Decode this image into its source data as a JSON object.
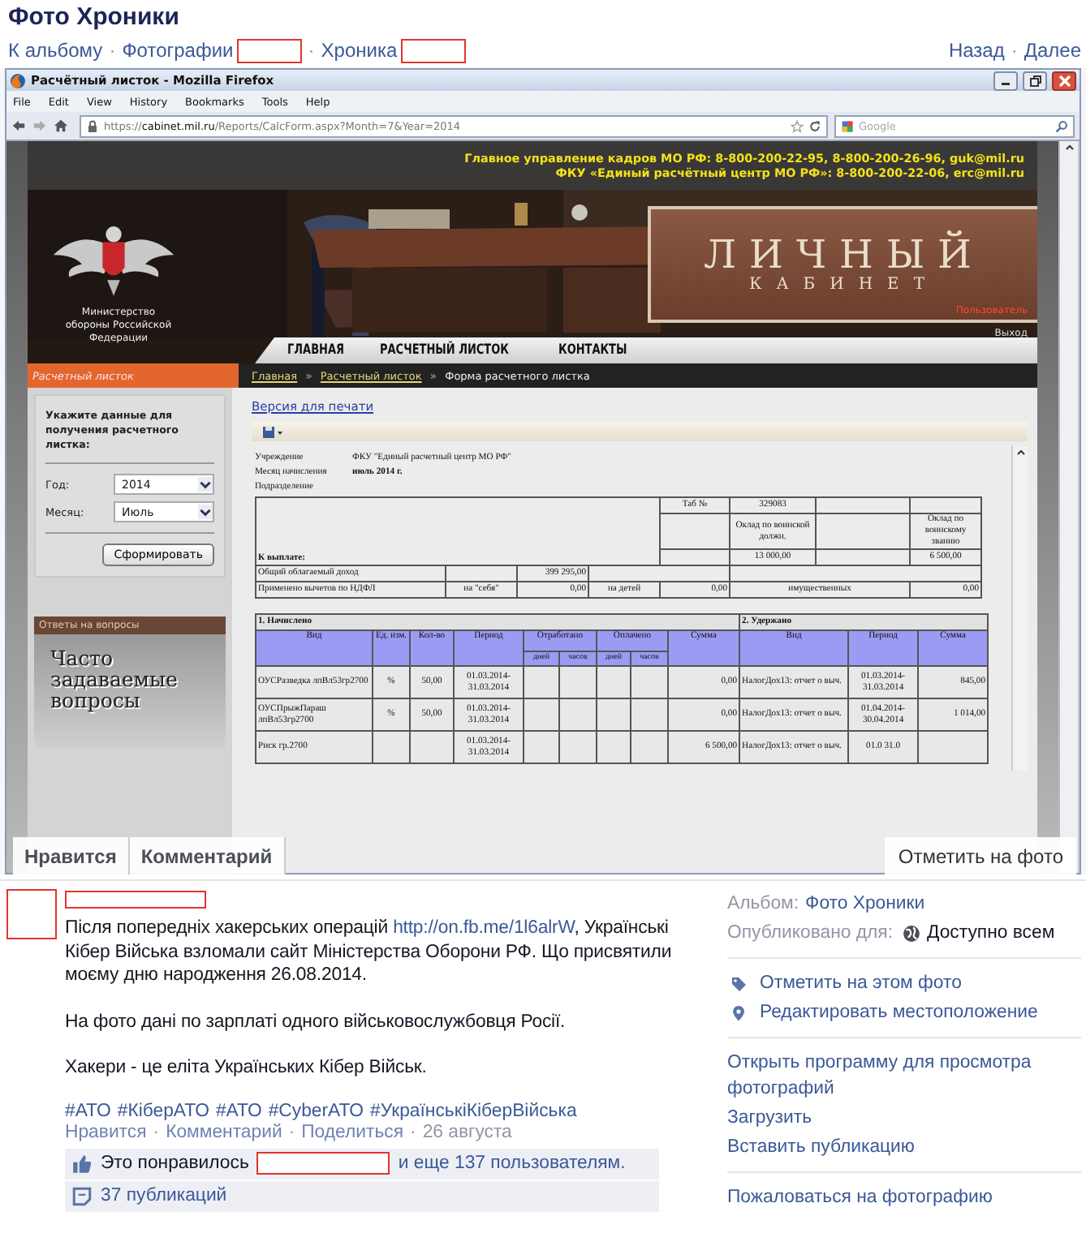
{
  "page_title": "Фото Хроники",
  "nav": {
    "separator": "·",
    "left": [
      {
        "label": "К альбому",
        "redacted": false
      },
      {
        "label": "Фотографии",
        "redacted": true
      },
      {
        "label": "Хроника",
        "redacted": true
      }
    ],
    "right": [
      "Назад",
      "Далее"
    ]
  },
  "photo": {
    "browser": {
      "title": "Расчётный листок - Mozilla Firefox",
      "menu": [
        "File",
        "Edit",
        "View",
        "History",
        "Bookmarks",
        "Tools",
        "Help"
      ],
      "url": "https://**cabinet.mil.ru**/Reports/CalcForm.aspx?Month=7&Year=2014",
      "search_placeholder": "Google"
    },
    "site": {
      "contacts": [
        "Главное управление кадров МО РФ: 8-800-200-22-95, 8-800-200-26-96, guk@mil.ru",
        "ФКУ «Единый расчётный центр МО РФ»: 8-800-200-22-06, erc@mil.ru"
      ],
      "logo_caption": "Министерство обороны Российской Федерации",
      "cabinet": {
        "title": "ЛИЧНЫЙ",
        "subtitle": "КАБИНЕТ",
        "user": "Пользователь",
        "logout": "Выход"
      },
      "menu": [
        "ГЛАВНАЯ",
        "РАСЧЕТНЫЙ ЛИСТОК",
        "КОНТАКТЫ"
      ],
      "sidebar_header": "Расчетный листок",
      "breadcrumb": {
        "separator": "»",
        "items": [
          {
            "label": "Главная",
            "link": true
          },
          {
            "label": "Расчетный листок",
            "link": true
          },
          {
            "label": "Форма расчетного листка",
            "link": false
          }
        ]
      },
      "form": {
        "prompt": "Укажите данные для получения расчетного листка:",
        "fields": [
          {
            "label": "Год:",
            "value": "2014"
          },
          {
            "label": "Месяц:",
            "value": "Июль"
          }
        ],
        "button": "Сформировать"
      },
      "faq": {
        "header": "Ответы на вопросы",
        "text": "Часто задаваемые вопросы"
      },
      "print_link": "Версия для печати",
      "report": {
        "info": [
          {
            "label": "Учреждение",
            "value": "ФКУ \"Единый расчетный центр МО РФ\""
          },
          {
            "label": "Месяц начисления",
            "value": "июль 2014 г."
          },
          {
            "label": "Подразделение"
          }
        ],
        "summary": {
          "tab_label": "Таб №",
          "tab_value": "329083",
          "salary_labels": [
            "Оклад по воинской должн.",
            "Оклад по воинскому званию"
          ],
          "pay_label": "К выплате:",
          "salary_values": [
            "13 000,00",
            "6 500,00"
          ],
          "income_label": "Общий облагаемый доход",
          "income_value": "399 295,00",
          "deductions_label": "Применено вычетов по НДФЛ",
          "deductions": [
            {
              "label": "на \"себя\"",
              "value": "0,00"
            },
            {
              "label": "на детей",
              "value": "0,00"
            },
            {
              "label": "имущественных",
              "value": "0,00"
            }
          ]
        },
        "accrued_title": "1. Начислено",
        "withheld_title": "2. Удержано",
        "columns": {
          "kind": "Вид",
          "unit": "Ед. изм.",
          "qty": "Кол-во",
          "period": "Период",
          "worked": "Отработано",
          "paid": "Оплачено",
          "sub": [
            "дней",
            "часов",
            "дней",
            "часов"
          ],
          "sum": "Сумма",
          "w_kind": "Вид",
          "w_period": "Период",
          "w_sum": "Сумма"
        },
        "rows": [
          [
            "ОУСРазведка лпВл53гр2700",
            "%",
            "50,00",
            "01.03.2014-31.03.2014",
            "",
            "",
            "",
            "",
            "0,00",
            "НалогДох13: отчет о выч.",
            "01.03.2014-31.03.2014",
            "845,00"
          ],
          [
            "ОУСПрыжПараш лпВл53гр2700",
            "%",
            "50,00",
            "01.03.2014-31.03.2014",
            "",
            "",
            "",
            "",
            "0,00",
            "НалогДох13: отчет о выч.",
            "01.04.2014-30.04.2014",
            "1 014,00"
          ],
          [
            "Риск гр.2700",
            "",
            "",
            "01.03.2014-31.03.2014",
            "",
            "",
            "",
            "",
            "6 500,00",
            "НалогДох13: отчет о выч.",
            "01.0 31.0"
          ]
        ]
      }
    },
    "overlay": {
      "buttons": [
        "Нравится",
        "Комментарий"
      ],
      "tag_button": "Отметить на фото"
    }
  },
  "post": {
    "avatar_redacted": true,
    "author_redacted": true,
    "paragraphs": [
      {
        "before": "Після попередніх хакерських операцій ",
        "link": "http://on.fb.me/1l6alrW",
        "after": ", Українські Кібер Війська взломали сайт Міністерства Оборони РФ. Що присвятили моєму дню народження 26.08.2014."
      },
      {
        "before": "На фото дані по зарплаті одного військовослужбовця Росії."
      },
      {
        "before": "Хакери - це еліта Українських Кібер Військ."
      }
    ],
    "hashtags": [
      "#АТО",
      "#КіберАТО",
      "#АТО",
      "#CyberАТО",
      "#УкраїнськіКіберВійська"
    ],
    "actions": {
      "separator": "·",
      "links": [
        "Нравится",
        "Комментарий",
        "Поделиться"
      ],
      "date": "26 августа"
    },
    "likes": {
      "prefix": "Это понравилось",
      "liker_redacted": true,
      "others": "и еще 137 пользователям."
    },
    "shares": "37 публикаций"
  },
  "sidebar": {
    "album_label": "Альбом:",
    "album": "Фото Хроники",
    "audience_label": "Опубликовано для:",
    "audience": "Доступно всем",
    "actions": [
      "Отметить на этом фото",
      "Редактировать местоположение"
    ],
    "links": [
      "Открыть программу для просмотра фотографий",
      "Загрузить",
      "Вставить публикацию"
    ],
    "report": "Пожаловаться на фотографию"
  }
}
